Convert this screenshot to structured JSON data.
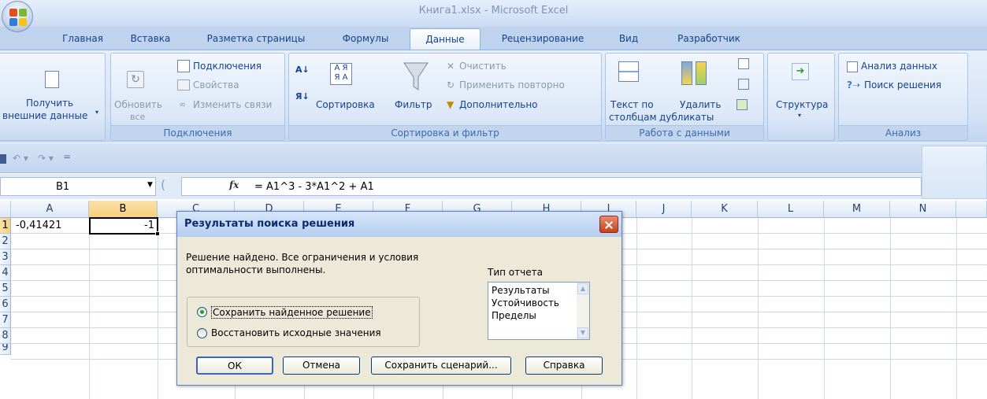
{
  "window": {
    "title": "Книга1.xlsx - Microsoft Excel"
  },
  "tabs": [
    {
      "label": "Главная"
    },
    {
      "label": "Вставка"
    },
    {
      "label": "Разметка страницы"
    },
    {
      "label": "Формулы"
    },
    {
      "label": "Данные",
      "active": true
    },
    {
      "label": "Рецензирование"
    },
    {
      "label": "Вид"
    },
    {
      "label": "Разработчик"
    }
  ],
  "ribbon": {
    "external": {
      "line1": "Получить",
      "line2": "внешние данные"
    },
    "connections": {
      "refresh_line1": "Обновить",
      "refresh_line2": "все",
      "connections": "Подключения",
      "properties": "Свойства",
      "edit_links": "Изменить связи",
      "label": "Подключения"
    },
    "sort_filter": {
      "sort": "Сортировка",
      "filter": "Фильтр",
      "clear": "Очистить",
      "reapply": "Применить повторно",
      "advanced": "Дополнительно",
      "label": "Сортировка и фильтр"
    },
    "data_tools": {
      "text_line1": "Текст по",
      "text_line2": "столбцам",
      "dup_line1": "Удалить",
      "dup_line2": "дубликаты",
      "label": "Работа с данными"
    },
    "outline": {
      "label": "Структура"
    },
    "analysis": {
      "data_analysis": "Анализ данных",
      "solver": "Поиск решения",
      "label": "Анализ"
    }
  },
  "formula_bar": {
    "name_box": "B1",
    "fx": "fx",
    "formula": "= A1^3 - 3*A1^2 + A1"
  },
  "grid": {
    "columns": [
      "A",
      "B",
      "C",
      "D",
      "E",
      "F",
      "G",
      "H",
      "I",
      "J",
      "K",
      "L",
      "M",
      "N"
    ],
    "rows": [
      "1",
      "2",
      "3",
      "4",
      "5",
      "6",
      "7",
      "8",
      "9"
    ],
    "cells": {
      "A1": "-0,41421",
      "B1": "-1"
    }
  },
  "dialog": {
    "title": "Результаты поиска решения",
    "message_line1": "Решение найдено. Все ограничения и условия",
    "message_line2": "оптимальности выполнены.",
    "report_type_label": "Тип отчета",
    "report_types": [
      "Результаты",
      "Устойчивость",
      "Пределы"
    ],
    "radio_keep": "Сохранить найденное решение",
    "radio_restore": "Восстановить исходные значения",
    "buttons": {
      "ok": "ОК",
      "cancel": "Отмена",
      "save_scenario": "Сохранить сценарий...",
      "help": "Справка"
    }
  },
  "colors": {
    "accent": "#15428b",
    "selection": "#f8cf7c",
    "close": "#c7421c"
  }
}
